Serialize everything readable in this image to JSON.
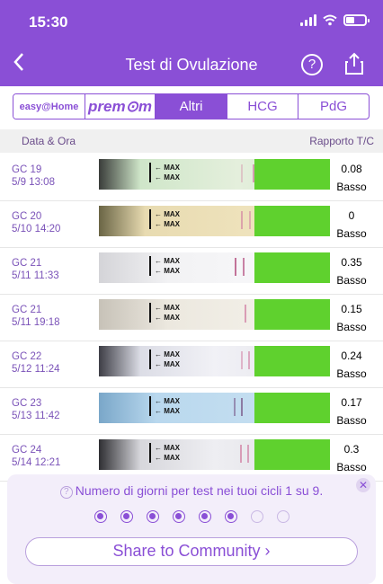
{
  "status": {
    "time": "15:30"
  },
  "header": {
    "title": "Test di Ovulazione"
  },
  "tabs": [
    {
      "label": "easy@Home"
    },
    {
      "label": "prem⊙m"
    },
    {
      "label": "Altri"
    },
    {
      "label": "HCG"
    },
    {
      "label": "PdG"
    }
  ],
  "columns": {
    "left": "Data & Ora",
    "right": "Rapporto T/C"
  },
  "strip_marker": "← MAX",
  "rows": [
    {
      "cycle": "GC 19",
      "datetime": "5/9 13:08",
      "ratio": "0.08",
      "level": "Basso"
    },
    {
      "cycle": "GC 20",
      "datetime": "5/10 14:20",
      "ratio": "0",
      "level": "Basso"
    },
    {
      "cycle": "GC 21",
      "datetime": "5/11 11:33",
      "ratio": "0.35",
      "level": "Basso"
    },
    {
      "cycle": "GC 21",
      "datetime": "5/11 19:18",
      "ratio": "0.15",
      "level": "Basso"
    },
    {
      "cycle": "GC 22",
      "datetime": "5/12 11:24",
      "ratio": "0.24",
      "level": "Basso"
    },
    {
      "cycle": "GC 23",
      "datetime": "5/13 11:42",
      "ratio": "0.17",
      "level": "Basso"
    },
    {
      "cycle": "GC 24",
      "datetime": "5/14 12:21",
      "ratio": "0.3",
      "level": "Basso"
    }
  ],
  "panel": {
    "info": "Numero di giorni per test nei tuoi cicli 1 su 9.",
    "progress_filled": 6,
    "progress_total": 8,
    "button": "Share to Community ›"
  },
  "colors": {
    "accent": "#8a4fd6",
    "grip": "#5fd12e"
  }
}
